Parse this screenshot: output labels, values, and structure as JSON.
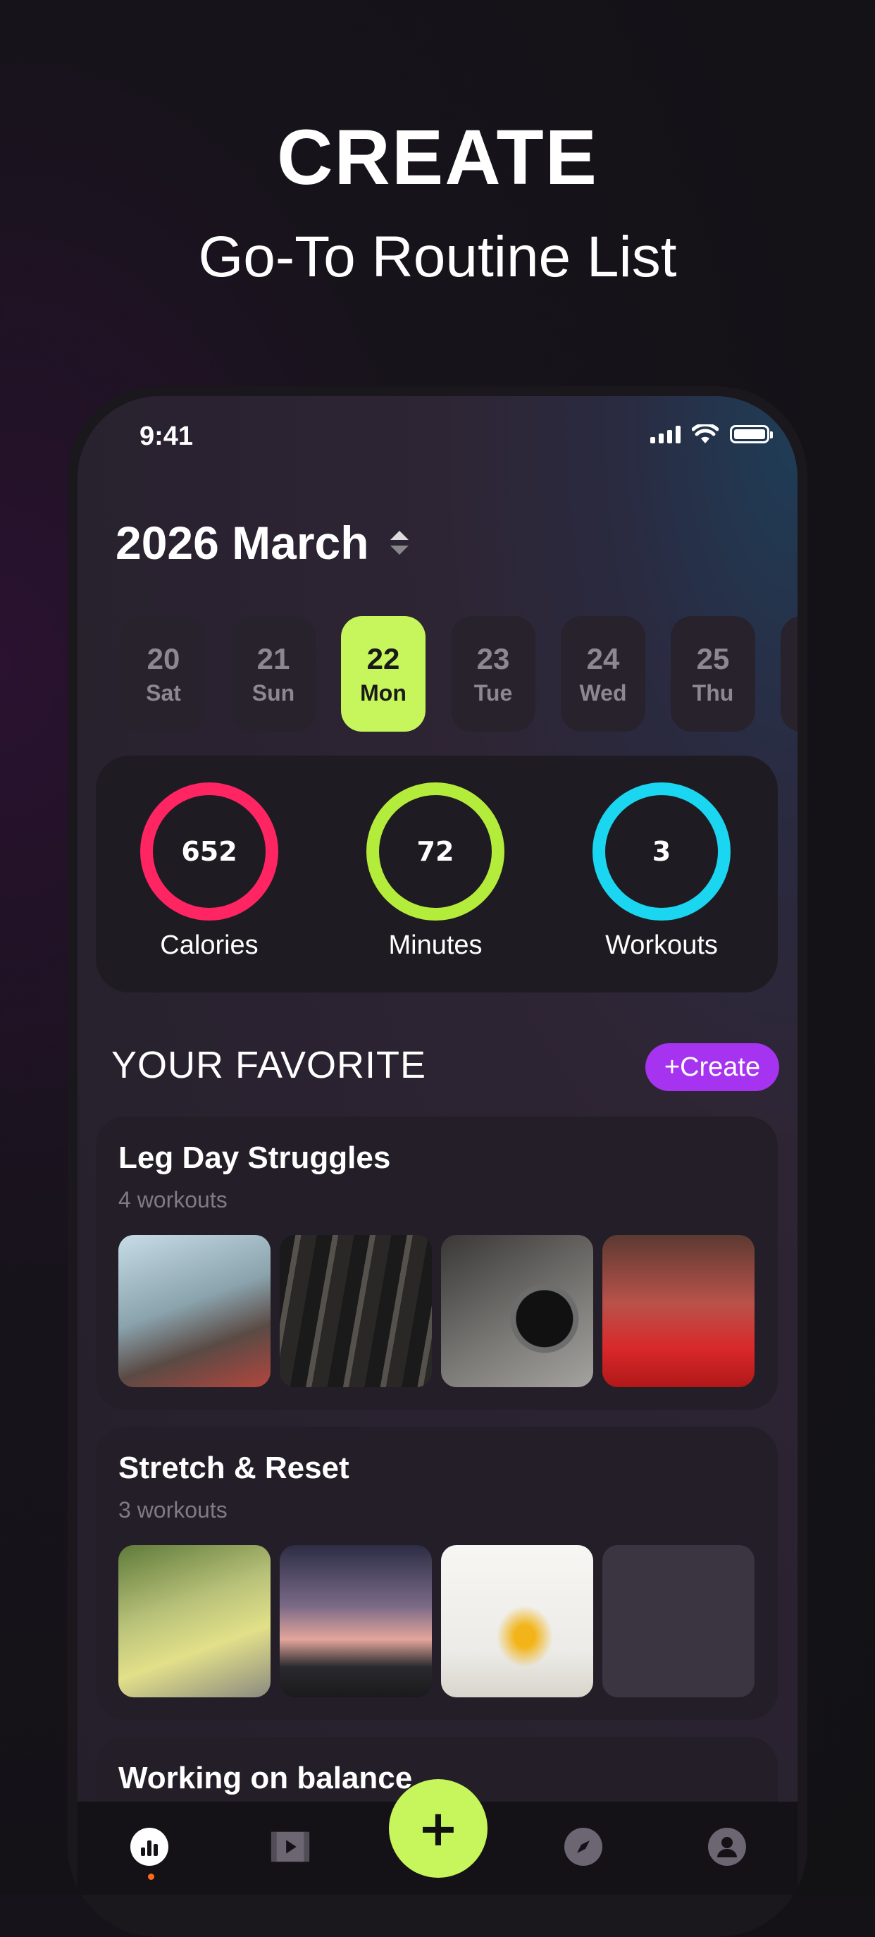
{
  "hero": {
    "title": "CREATE",
    "subtitle": "Go-To Routine List"
  },
  "status_bar": {
    "time": "9:41"
  },
  "header": {
    "month": "2026 March"
  },
  "days": [
    {
      "num": "20",
      "name": "Sat"
    },
    {
      "num": "21",
      "name": "Sun"
    },
    {
      "num": "22",
      "name": "Mon",
      "selected": true
    },
    {
      "num": "23",
      "name": "Tue"
    },
    {
      "num": "24",
      "name": "Wed"
    },
    {
      "num": "25",
      "name": "Thu"
    }
  ],
  "stats": [
    {
      "value": "652",
      "label": "Calories",
      "color": "#ff2462"
    },
    {
      "value": "72",
      "label": "Minutes",
      "color": "#b4ec3c"
    },
    {
      "value": "3",
      "label": "Workouts",
      "color": "#1ad6f0"
    }
  ],
  "favorites": {
    "title": "YOUR FAVORITE",
    "create_label": "+Create",
    "routines": [
      {
        "title": "Leg Day Struggles",
        "count": "4 workouts"
      },
      {
        "title": "Stretch & Reset",
        "count": "3 workouts"
      },
      {
        "title": "Working on balance",
        "count": ""
      }
    ]
  },
  "nav": {
    "fab_label": "+",
    "items": [
      "stats-icon",
      "video-icon",
      "compass-icon",
      "profile-icon"
    ]
  },
  "colors": {
    "accent_lime": "#c6f65c",
    "accent_purple": "#a633f0"
  }
}
